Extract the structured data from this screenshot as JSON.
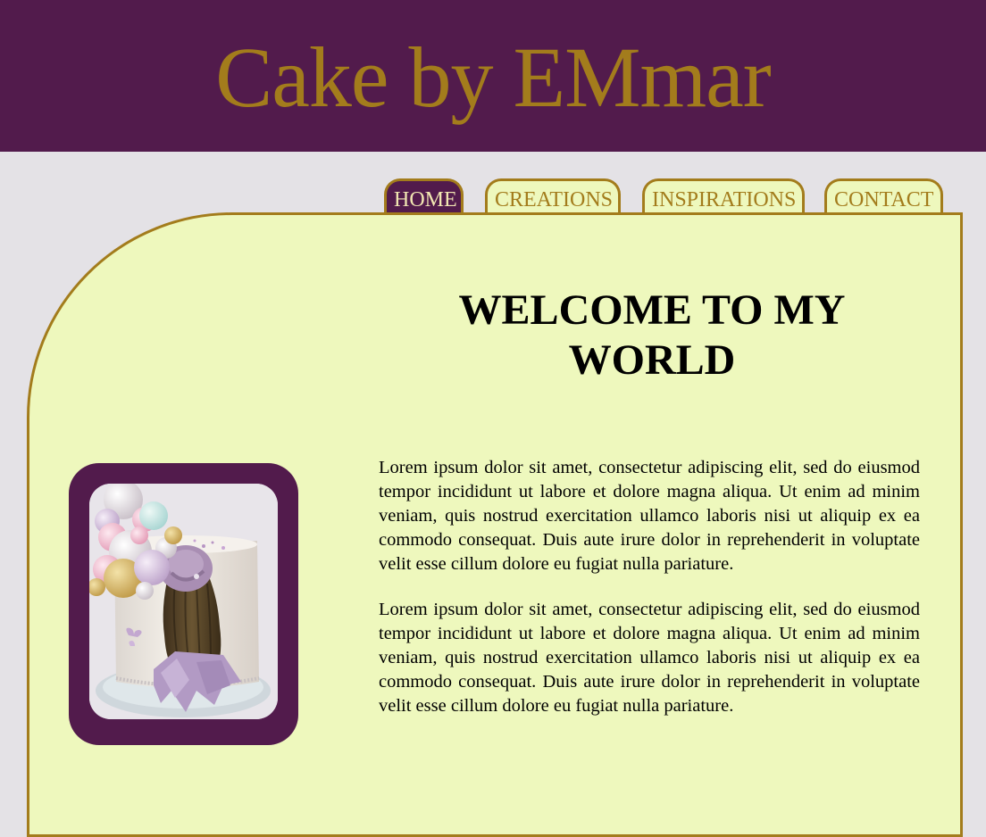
{
  "site": {
    "title": "Cake by EMmar"
  },
  "nav": {
    "tabs": [
      {
        "label": "HOME",
        "active": true
      },
      {
        "label": "CREATIONS",
        "active": false
      },
      {
        "label": "INSPIRATIONS",
        "active": false
      },
      {
        "label": "CONTACT",
        "active": false
      }
    ]
  },
  "main": {
    "heading": "WELCOME TO MY WORLD",
    "paragraphs": [
      "Lorem ipsum dolor sit amet, consectetur adipiscing elit, sed do eiusmod tempor incididunt ut labore et dolore magna aliqua. Ut enim ad minim veniam, quis nostrud exercitation ullamco laboris nisi ut aliquip ex ea commodo consequat. Duis aute irure dolor in reprehenderit in voluptate velit esse cillum dolore eu fugiat nulla pariature.",
      "Lorem ipsum dolor sit amet, consectetur adipiscing elit, sed do eiusmod tempor incididunt ut labore et dolore magna aliqua. Ut enim ad minim veniam, quis nostrud exercitation ullamco laboris nisi ut aliquip ex ea commodo consequat. Duis aute irure dolor in reprehenderit in voluptate velit esse cillum dolore eu fugiat nulla pariature."
    ]
  },
  "colors": {
    "header_bg": "#521b4c",
    "gold": "#a37c1c",
    "panel_bg": "#eef8bd",
    "page_bg": "#e4e2e6"
  },
  "image": {
    "icon": "cake-photo"
  }
}
